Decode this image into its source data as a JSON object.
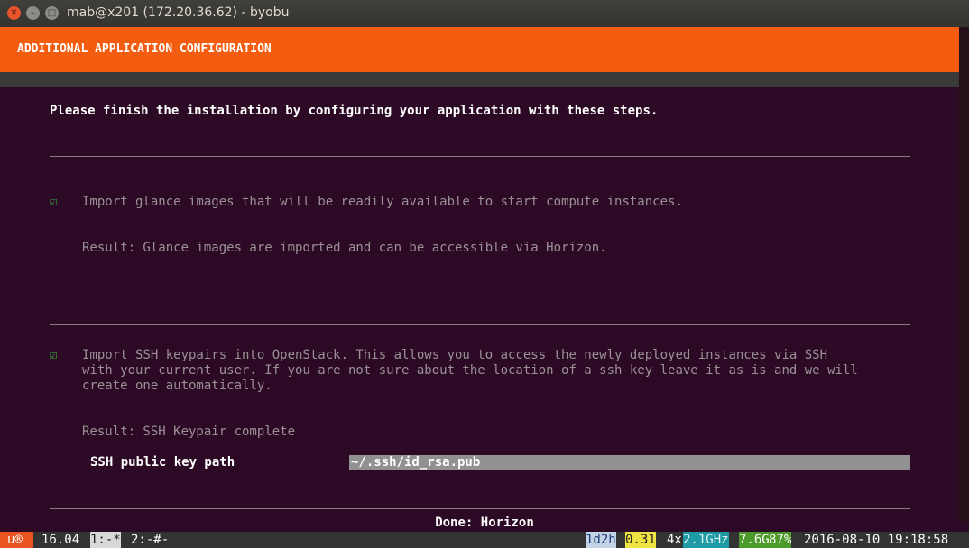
{
  "window": {
    "title": "mab@x201 (172.20.36.62) - byobu"
  },
  "header": {
    "title": "ADDITIONAL APPLICATION CONFIGURATION"
  },
  "intro": "Please finish the installation by configuring your application with these steps.",
  "steps": [
    {
      "check": "☑",
      "description": "Import glance images that will be readily available to start compute instances.",
      "result": "Result: Glance images are imported and can be accessible via Horizon."
    },
    {
      "check": "☑",
      "description_lines": [
        "Import SSH keypairs into OpenStack. This allows you to access the newly deployed instances via SSH",
        "with your current user. If you are not sure about the location of a ssh key leave it as is and we will",
        "create one automatically."
      ],
      "result": "Result: SSH Keypair complete",
      "field_label": "SSH public key path",
      "field_value": "~/.ssh/id_rsa.pub"
    }
  ],
  "footer": {
    "done": "Done: Horizon"
  },
  "statusbar": {
    "logo": "u®",
    "version": "16.04",
    "window1": "1:-*",
    "window2": "2:-#-",
    "uptime": "1d2h",
    "load": "0.31",
    "cpu_count": "4x",
    "cpu_freq": "2.1GHz",
    "mem": "7.6G",
    "mem_pct": "87%",
    "datetime": "2016-08-10 19:18:58"
  },
  "colors": {
    "accent": "#f45c0f",
    "background": "#2c0a25",
    "check": "#36b33c"
  }
}
